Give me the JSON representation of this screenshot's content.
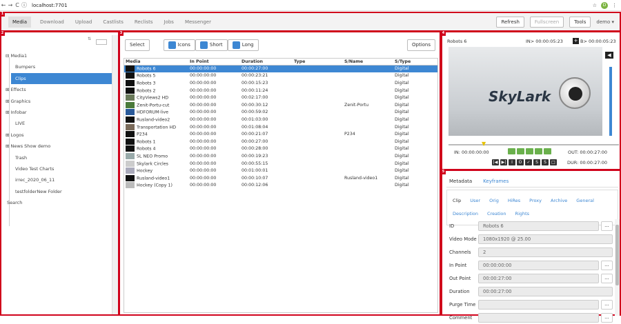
{
  "browser": {
    "url": "localhost:7701",
    "back": "←",
    "forward": "→",
    "reload": "C",
    "star": "☆",
    "avatar": "D",
    "more": "⋮"
  },
  "menu": {
    "items": [
      "Media",
      "Download",
      "Upload",
      "Castlists",
      "Reclists",
      "Jobs",
      "Messenger"
    ],
    "active": "Media"
  },
  "topbar": {
    "refresh": "Refresh",
    "fullscreen": "Fullscreen",
    "tools": "Tools",
    "user": "demo ▾"
  },
  "badges": {
    "b1": "1",
    "b2": "2",
    "b3": "3",
    "b4": "4",
    "b5": "5"
  },
  "tree": {
    "root": "⊟ Media1",
    "items": [
      "Bumpers",
      "Clips",
      "⊞ Effects",
      "⊞ Graphics",
      "⊞ Infobar",
      "LIVE",
      "⊞ Logos",
      "⊞ News Show demo",
      "Trash",
      "Video Test Charts",
      "irrec_2020_06_11",
      "testfolderNew Folder"
    ],
    "selected": "Clips",
    "search": "Search"
  },
  "toolbar": {
    "select": "Select",
    "icons": "Icons",
    "short": "Short",
    "long": "Long",
    "options": "Options"
  },
  "grid": {
    "columns": [
      "Media",
      "In Point",
      "Duration",
      "Type",
      "S/Name",
      "S/Type"
    ],
    "rows": [
      [
        "Robots 6",
        "00:00:00:00",
        "00:00:27:00",
        "",
        "",
        "Digital"
      ],
      [
        "Robots 5",
        "00:00:00:00",
        "00:00:23:21",
        "",
        "",
        "Digital"
      ],
      [
        "Robots 3",
        "00:00:00:00",
        "00:00:15:23",
        "",
        "",
        "Digital"
      ],
      [
        "Robots 2",
        "00:00:00:00",
        "00:00:11:24",
        "",
        "",
        "Digital"
      ],
      [
        "CityViews2 HD",
        "00:00:00:00",
        "00:02:17:00",
        "",
        "",
        "Digital"
      ],
      [
        "Zenit-Portu-cut",
        "00:00:00:00",
        "00:00:30:12",
        "",
        "Zenit-Portu",
        "Digital"
      ],
      [
        "HDFORUM-live",
        "00:00:00:00",
        "00:00:59:02",
        "",
        "",
        "Digital"
      ],
      [
        "Rusland-video2",
        "00:00:00:00",
        "00:01:03:00",
        "",
        "",
        "Digital"
      ],
      [
        "Transportation HD",
        "00:00:00:00",
        "00:01:08:04",
        "",
        "",
        "Digital"
      ],
      [
        "P234",
        "00:00:00:00",
        "00:00:21:07",
        "",
        "P234",
        "Digital"
      ],
      [
        "Robots 1",
        "00:00:00:00",
        "00:00:27:00",
        "",
        "",
        "Digital"
      ],
      [
        "Robots 4",
        "00:00:00:00",
        "00:00:28:00",
        "",
        "",
        "Digital"
      ],
      [
        "SL NEO Promo",
        "00:00:00:00",
        "00:00:19:23",
        "",
        "",
        "Digital"
      ],
      [
        "Skylark Circles",
        "00:00:00:00",
        "00:00:55:15",
        "",
        "",
        "Digital"
      ],
      [
        "Hockey",
        "00:00:00:00",
        "00:01:00:01",
        "",
        "",
        "Digital"
      ],
      [
        "Rusland-video1",
        "00:00:00:00",
        "00:00:10:07",
        "",
        "Rusland-video1",
        "Digital"
      ],
      [
        "Hockey (Copy 1)",
        "00:00:00:00",
        "00:00:12:06",
        "",
        "",
        "Digital"
      ]
    ]
  },
  "player": {
    "title": "Robots 6",
    "in_label": "IN> 00:00:05:23",
    "out_label": "B> 00:00:05:23",
    "logo": "SkyLark",
    "in_time": "IN: 00:00:00:00",
    "out_time": "OUT: 00:00:27:00",
    "dur_time": "DUR: 00:00:27:00",
    "colors": {
      "play": "#6ab04c",
      "accent": "#3d87d3"
    }
  },
  "metadata": {
    "tabs": [
      "Metadata",
      "Keyframes"
    ],
    "subtabs": [
      "Clip",
      "User",
      "Orig",
      "HiRes",
      "Proxy",
      "Archive",
      "General",
      "Description",
      "Creation",
      "Rights"
    ],
    "fields": [
      {
        "label": "ID",
        "value": "Robots 6",
        "dots": true
      },
      {
        "label": "Video Mode",
        "value": "1080x1920 @ 25.00",
        "dots": false
      },
      {
        "label": "Channels",
        "value": "2",
        "dots": false
      },
      {
        "label": "In Point",
        "value": "00:00:00:00",
        "dots": true
      },
      {
        "label": "Out Point",
        "value": "00:00:27:00",
        "dots": true
      },
      {
        "label": "Duration",
        "value": "00:00:27:00",
        "dots": false
      },
      {
        "label": "Purge Time",
        "value": "",
        "dots": true
      },
      {
        "label": "Comment",
        "value": "",
        "dots": true
      }
    ]
  }
}
